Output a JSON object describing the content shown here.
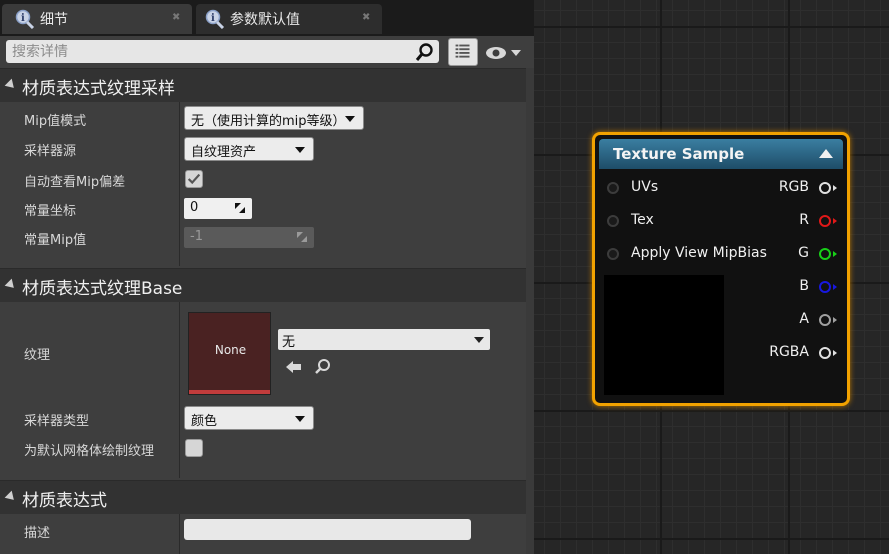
{
  "tabs": [
    {
      "label": "细节",
      "icon": "details-icon"
    },
    {
      "label": "参数默认值",
      "icon": "details-icon"
    }
  ],
  "search": {
    "placeholder": "搜索详情"
  },
  "sections": {
    "s1": {
      "title": "材质表达式纹理采样"
    },
    "s2": {
      "title": "材质表达式纹理Base"
    },
    "s3": {
      "title": "材质表达式"
    }
  },
  "props": {
    "mip_mode": {
      "label": "Mip值模式",
      "value": "无（使用计算的mip等级）"
    },
    "sampler_source": {
      "label": "采样器源",
      "value": "自纹理资产"
    },
    "auto_mip_bias": {
      "label": "自动查看Mip偏差",
      "checked": true
    },
    "const_coord": {
      "label": "常量坐标",
      "value": "0"
    },
    "const_mip": {
      "label": "常量Mip值",
      "value": "-1"
    },
    "texture": {
      "label": "纹理",
      "thumb_text": "None",
      "value": "无"
    },
    "sampler_type": {
      "label": "采样器类型",
      "value": "颜色"
    },
    "default_mesh": {
      "label": "为默认网格体绘制纹理",
      "checked": false
    },
    "desc": {
      "label": "描述",
      "value": ""
    }
  },
  "node": {
    "title": "Texture Sample",
    "inputs": [
      {
        "label": "UVs"
      },
      {
        "label": "Tex"
      },
      {
        "label": "Apply View MipBias"
      }
    ],
    "outputs": [
      {
        "label": "RGB",
        "color": "#e0e0e0"
      },
      {
        "label": "R",
        "color": "#e01818"
      },
      {
        "label": "G",
        "color": "#18d018"
      },
      {
        "label": "B",
        "color": "#1818e0"
      },
      {
        "label": "A",
        "color": "#a0a0a0"
      },
      {
        "label": "RGBA",
        "color": "#e0e0e0"
      }
    ]
  },
  "colors": {
    "node_border": "#f2a200",
    "header": "#2f6f90"
  }
}
